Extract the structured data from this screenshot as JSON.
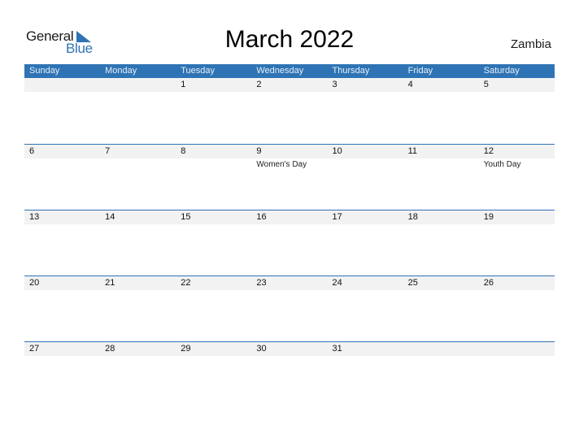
{
  "logo": {
    "text_general": "General",
    "text_blue": "Blue",
    "icon": "triangle-flag-icon",
    "brand_color": "#2e74b5"
  },
  "title": "March 2022",
  "country": "Zambia",
  "colors": {
    "header_bg": "#2e74b5",
    "date_strip_bg": "#f2f2f2",
    "rule": "#2e74b5"
  },
  "weekdays": [
    "Sunday",
    "Monday",
    "Tuesday",
    "Wednesday",
    "Thursday",
    "Friday",
    "Saturday"
  ],
  "weeks": [
    [
      {
        "day": ""
      },
      {
        "day": ""
      },
      {
        "day": "1"
      },
      {
        "day": "2"
      },
      {
        "day": "3"
      },
      {
        "day": "4"
      },
      {
        "day": "5"
      }
    ],
    [
      {
        "day": "6"
      },
      {
        "day": "7"
      },
      {
        "day": "8"
      },
      {
        "day": "9",
        "holiday": "Women's Day"
      },
      {
        "day": "10"
      },
      {
        "day": "11"
      },
      {
        "day": "12",
        "holiday": "Youth Day"
      }
    ],
    [
      {
        "day": "13"
      },
      {
        "day": "14"
      },
      {
        "day": "15"
      },
      {
        "day": "16"
      },
      {
        "day": "17"
      },
      {
        "day": "18"
      },
      {
        "day": "19"
      }
    ],
    [
      {
        "day": "20"
      },
      {
        "day": "21"
      },
      {
        "day": "22"
      },
      {
        "day": "23"
      },
      {
        "day": "24"
      },
      {
        "day": "25"
      },
      {
        "day": "26"
      }
    ],
    [
      {
        "day": "27"
      },
      {
        "day": "28"
      },
      {
        "day": "29"
      },
      {
        "day": "30"
      },
      {
        "day": "31"
      },
      {
        "day": ""
      },
      {
        "day": ""
      }
    ]
  ]
}
